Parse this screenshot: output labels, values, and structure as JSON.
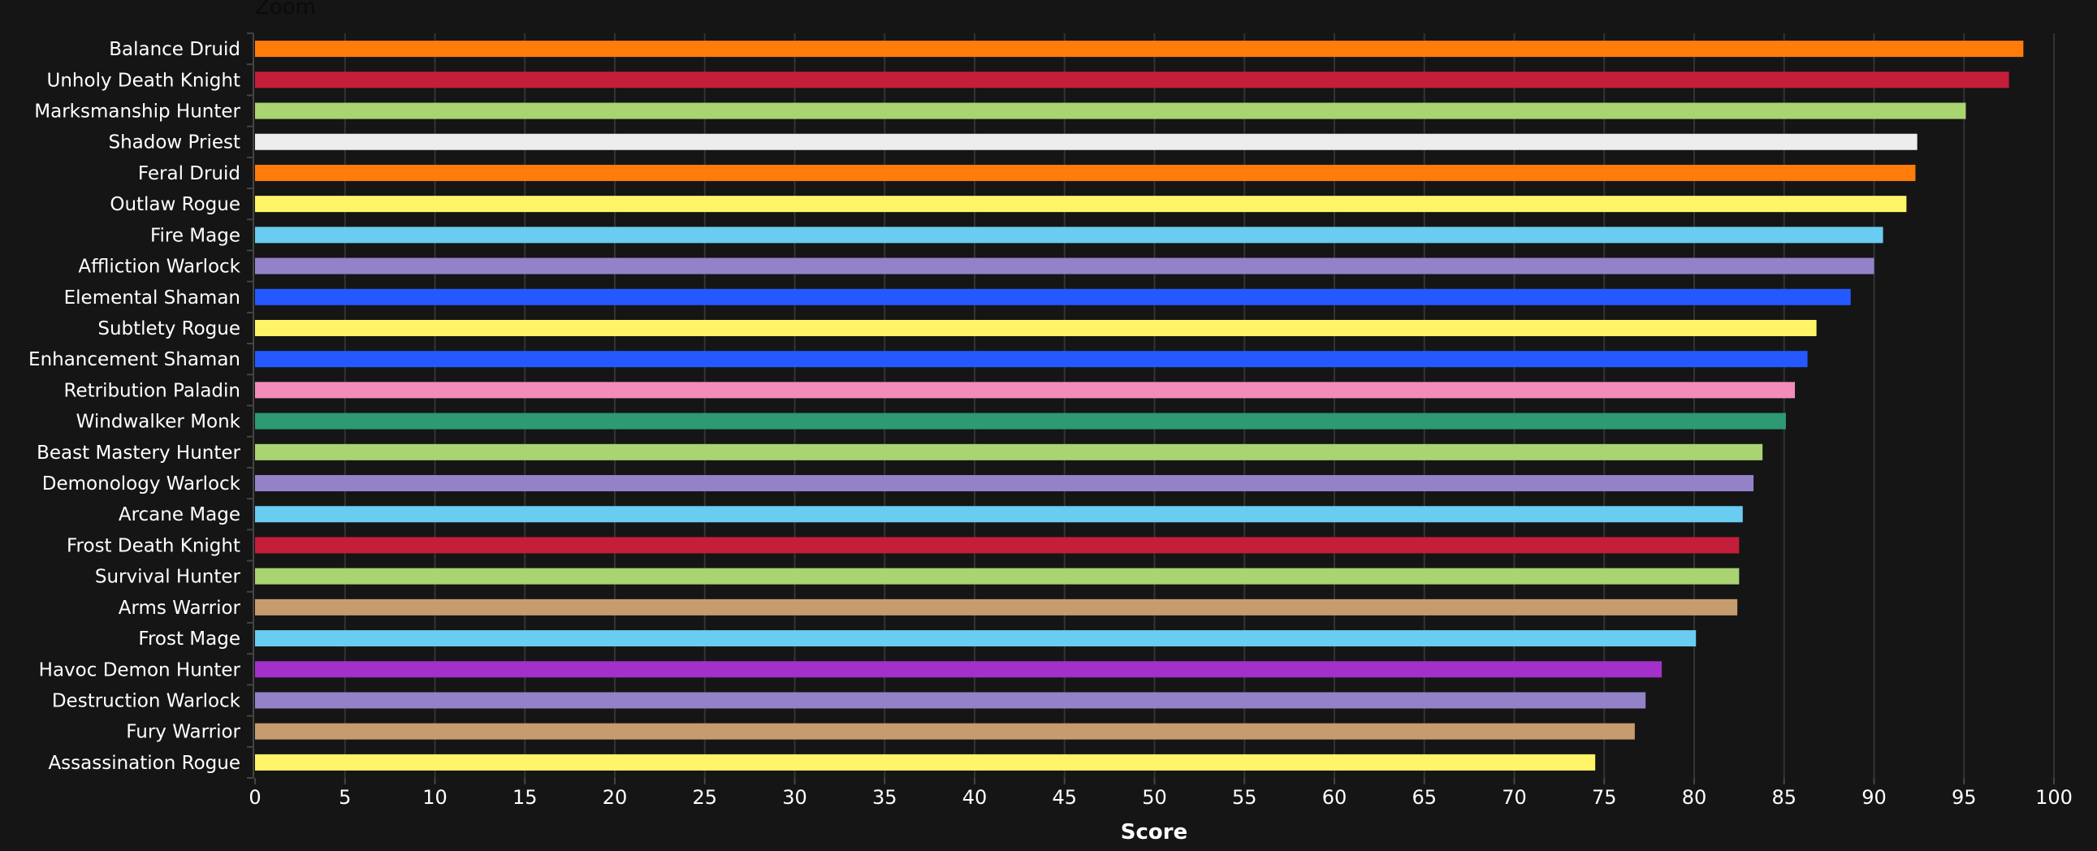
{
  "header": {
    "zoom_label": "Zoom"
  },
  "chart_data": {
    "type": "bar",
    "orientation": "horizontal",
    "title": "",
    "xlabel": "Score",
    "ylabel": "",
    "xlim": [
      0,
      100
    ],
    "xticks": [
      0,
      5,
      10,
      15,
      20,
      25,
      30,
      35,
      40,
      45,
      50,
      55,
      60,
      65,
      70,
      75,
      80,
      85,
      90,
      95,
      100
    ],
    "grid": true,
    "legend": "none",
    "categories": [
      "Balance Druid",
      "Unholy Death Knight",
      "Marksmanship Hunter",
      "Shadow Priest",
      "Feral Druid",
      "Outlaw Rogue",
      "Fire Mage",
      "Affliction Warlock",
      "Elemental Shaman",
      "Subtlety Rogue",
      "Enhancement Shaman",
      "Retribution Paladin",
      "Windwalker Monk",
      "Beast Mastery Hunter",
      "Demonology Warlock",
      "Arcane Mage",
      "Frost Death Knight",
      "Survival Hunter",
      "Arms Warrior",
      "Frost Mage",
      "Havoc Demon Hunter",
      "Destruction Warlock",
      "Fury Warrior",
      "Assassination Rogue"
    ],
    "values": [
      98.3,
      97.5,
      95.1,
      92.4,
      92.3,
      91.8,
      90.5,
      90.0,
      88.7,
      86.8,
      86.3,
      85.6,
      85.1,
      83.8,
      83.3,
      82.7,
      82.5,
      82.5,
      82.4,
      80.1,
      78.2,
      77.3,
      76.7,
      74.5
    ],
    "colors": [
      "#FF7C0A",
      "#C41E3A",
      "#AAD372",
      "#EDEDED",
      "#FF7C0A",
      "#FFF468",
      "#69CCF0",
      "#9482C9",
      "#2459FF",
      "#FFF468",
      "#2459FF",
      "#F48CBA",
      "#2D9A73",
      "#AAD372",
      "#9482C9",
      "#69CCF0",
      "#C41E3A",
      "#AAD372",
      "#C69B6D",
      "#69CCF0",
      "#A330C9",
      "#9482C9",
      "#C69B6D",
      "#FFF468"
    ]
  }
}
